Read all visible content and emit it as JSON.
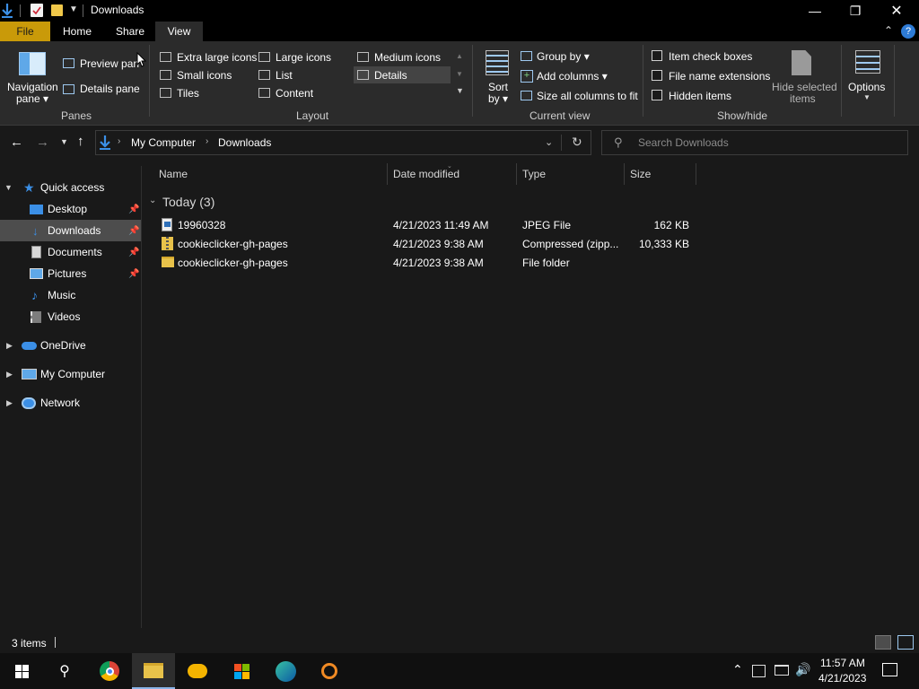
{
  "window": {
    "title": "Downloads"
  },
  "tabs": {
    "file": "File",
    "home": "Home",
    "share": "Share",
    "view": "View"
  },
  "ribbon": {
    "panes": {
      "navigation_pane_1": "Navigation",
      "navigation_pane_2": "pane",
      "preview_pane": "Preview pan",
      "details_pane": "Details pane",
      "group": "Panes"
    },
    "layout": {
      "options": [
        "Extra large icons",
        "Large icons",
        "Medium icons",
        "Small icons",
        "List",
        "Details",
        "Tiles",
        "Content"
      ],
      "selected": "Details",
      "group": "Layout"
    },
    "current_view": {
      "sort_1": "Sort",
      "sort_2": "by",
      "group_by": "Group by",
      "add_columns": "Add columns",
      "size_all": "Size all columns to fit",
      "group": "Current view"
    },
    "show_hide": {
      "item_check_boxes": "Item check boxes",
      "file_name_extensions": "File name extensions",
      "hidden_items": "Hidden items",
      "hide_selected_1": "Hide selected",
      "hide_selected_2": "items",
      "group": "Show/hide"
    },
    "options": "Options"
  },
  "address": {
    "crumbs": [
      "My Computer",
      "Downloads"
    ],
    "search_placeholder": "Search Downloads"
  },
  "nav": {
    "quick_access": "Quick access",
    "items": [
      "Desktop",
      "Downloads",
      "Documents",
      "Pictures",
      "Music",
      "Videos"
    ],
    "onedrive": "OneDrive",
    "my_computer": "My Computer",
    "network": "Network"
  },
  "columns": {
    "name": "Name",
    "date": "Date modified",
    "type": "Type",
    "size": "Size"
  },
  "group_header": "Today (3)",
  "files": [
    {
      "name": "19960328",
      "date": "4/21/2023 11:49 AM",
      "type": "JPEG File",
      "size": "162 KB",
      "icon": "image-file-icon"
    },
    {
      "name": "cookieclicker-gh-pages",
      "date": "4/21/2023 9:38 AM",
      "type": "Compressed (zipp...",
      "size": "10,333 KB",
      "icon": "zip-folder-icon"
    },
    {
      "name": "cookieclicker-gh-pages",
      "date": "4/21/2023 9:38 AM",
      "type": "File folder",
      "size": "",
      "icon": "folder-icon"
    }
  ],
  "status": {
    "count": "3 items"
  },
  "taskbar": {
    "time": "11:57 AM",
    "date": "4/21/2023"
  },
  "colors": {
    "accent_file_tab": "#c99a09",
    "folder": "#e8c24a",
    "selection": "#4d4d4d",
    "link_blue": "#4aa3f0"
  }
}
